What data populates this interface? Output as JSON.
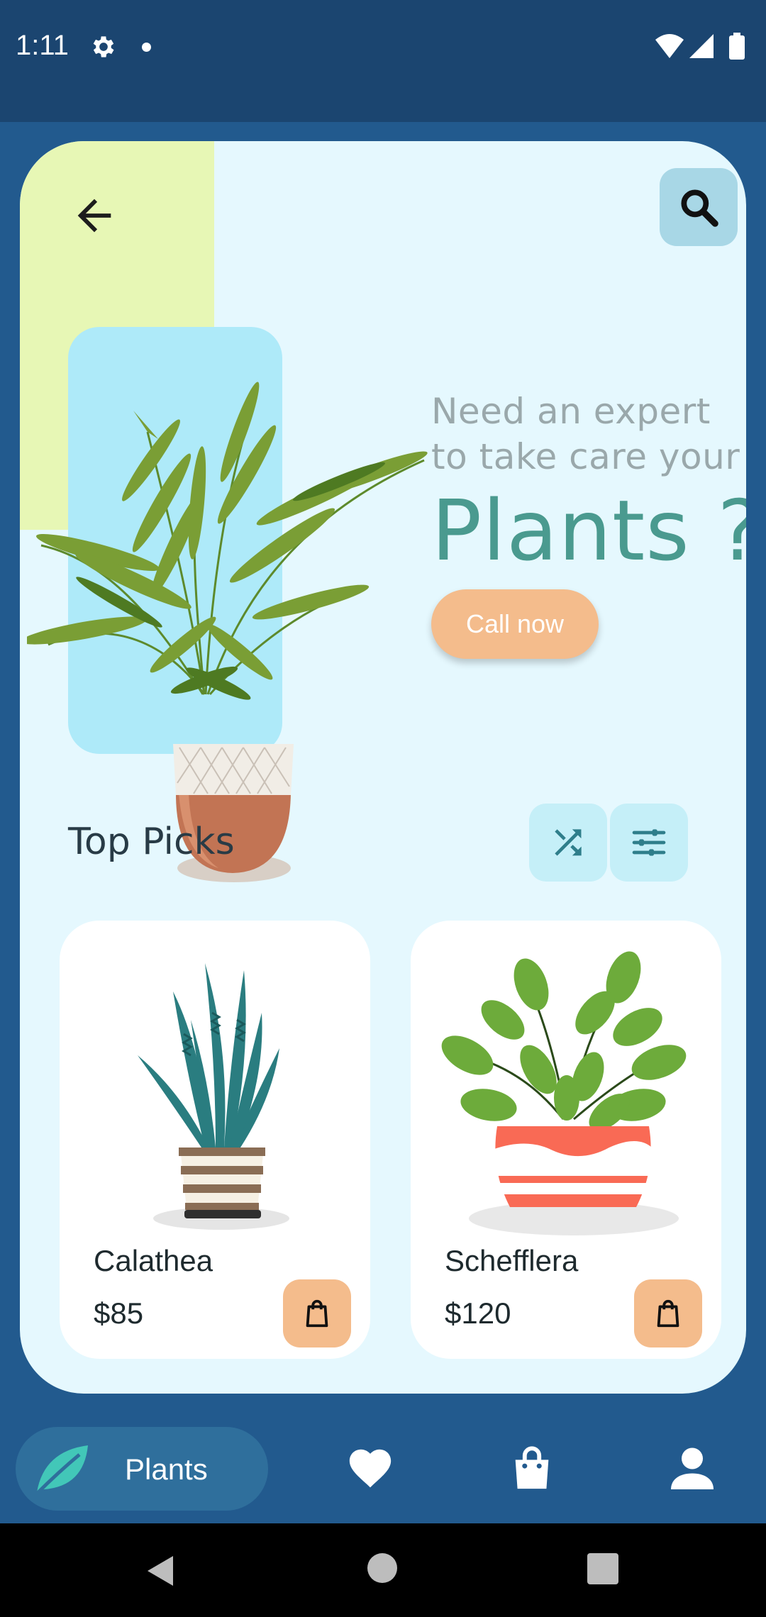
{
  "status_bar": {
    "time": "1:11",
    "icons": [
      "settings-icon",
      "notification-dot",
      "wifi-icon",
      "signal-icon",
      "battery-icon"
    ]
  },
  "hero": {
    "line1": "Need an expert",
    "line2": "to take care your",
    "headline": "Plants ?",
    "call_button": "Call now",
    "back_icon": "arrow-left-icon",
    "search_icon": "search-icon"
  },
  "top_picks": {
    "title": "Top Picks",
    "shuffle_icon": "shuffle-icon",
    "filter_icon": "sliders-icon",
    "products": [
      {
        "name": "Calathea",
        "price": "$85",
        "image": "snake-plant-striped-pot"
      },
      {
        "name": "Schefflera",
        "price": "$120",
        "image": "leafy-plant-red-pot"
      }
    ]
  },
  "bottom_nav": {
    "active_label": "Plants",
    "items": [
      "leaf-icon",
      "heart-icon",
      "shopping-bag-icon",
      "profile-icon"
    ]
  },
  "colors": {
    "background": "#225a8e",
    "status_bar": "#1b4570",
    "card": "#e5f8fe",
    "accent_orange": "#f4bc8c",
    "headline_teal": "#4a9a8f",
    "nav_active": "#2f6f9c"
  }
}
